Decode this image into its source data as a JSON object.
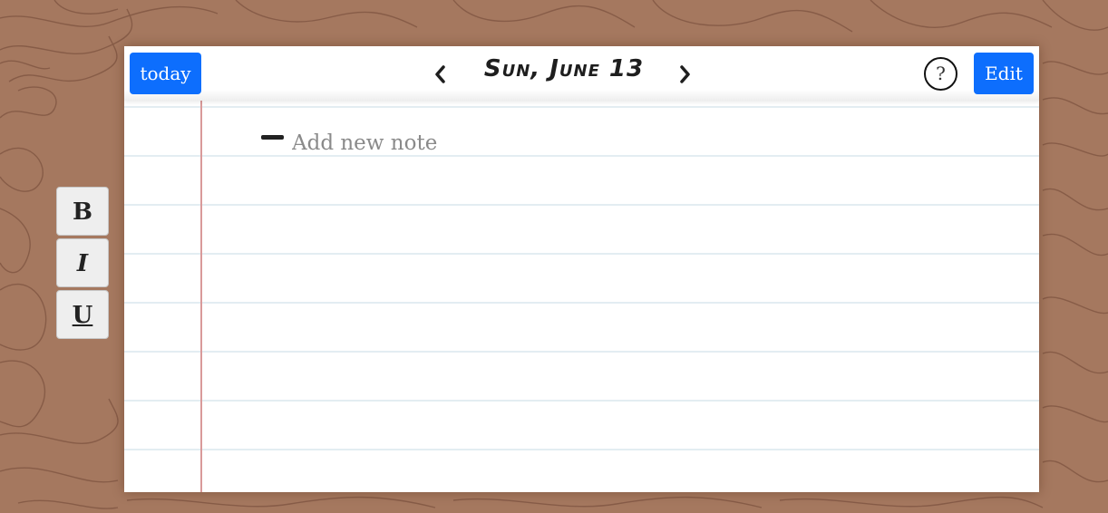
{
  "header": {
    "today_label": "today",
    "date_title": "Sun, June 13",
    "help_label": "?",
    "edit_label": "Edit"
  },
  "note": {
    "placeholder": "Add new note",
    "value": ""
  },
  "toolbar": {
    "bold_label": "B",
    "italic_label": "I",
    "underline_label": "U"
  },
  "icons": {
    "prev": "chevron-left-icon",
    "next": "chevron-right-icon",
    "help": "question-icon"
  },
  "colors": {
    "background": "#a5785f",
    "accent": "#0d6efd",
    "margin_line": "#d99a9a",
    "rule_line": "#e3edf2"
  }
}
